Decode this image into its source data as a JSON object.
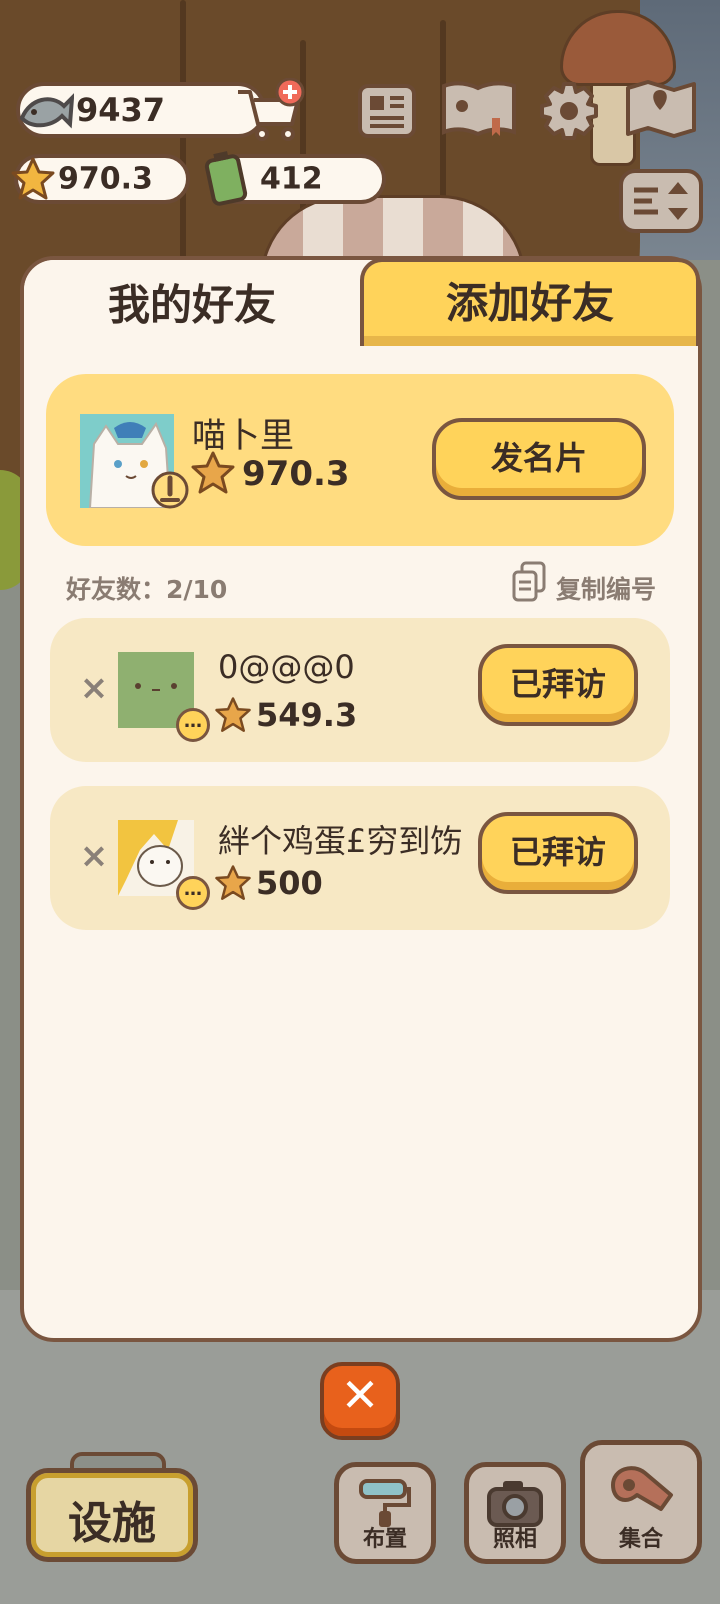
{
  "resources": {
    "fish": "9437",
    "stars": "970.3",
    "battery": "412"
  },
  "tabs": {
    "mine": "我的好友",
    "add": "添加好友"
  },
  "me": {
    "name": "喵卜里",
    "score": "970.3",
    "button": "发名片"
  },
  "friends_meta": {
    "count": "好友数：2/10",
    "copy": "复制编号"
  },
  "friends": [
    {
      "name": "0@@@0",
      "score": "549.3",
      "button": "已拜访"
    },
    {
      "name": "絆个鸡蛋£穷到饬",
      "score": "500",
      "button": "已拜访"
    }
  ],
  "bottom": {
    "facility": "设施",
    "layout": "布置",
    "photo": "照相",
    "gather": "集合"
  },
  "colors": {
    "accent": "#ffd35a",
    "panel": "#fcf5ec",
    "border": "#7a5640",
    "close": "#e8611c"
  },
  "icons": [
    "fish-icon",
    "star-icon",
    "battery-icon",
    "shopping-cart-add-icon",
    "newspaper-icon",
    "paw-book-icon",
    "gear-icon",
    "map-icon",
    "sort-toggle-icon",
    "copy-icon",
    "close-icon",
    "paint-roller-icon",
    "camera-icon",
    "whistle-icon"
  ]
}
